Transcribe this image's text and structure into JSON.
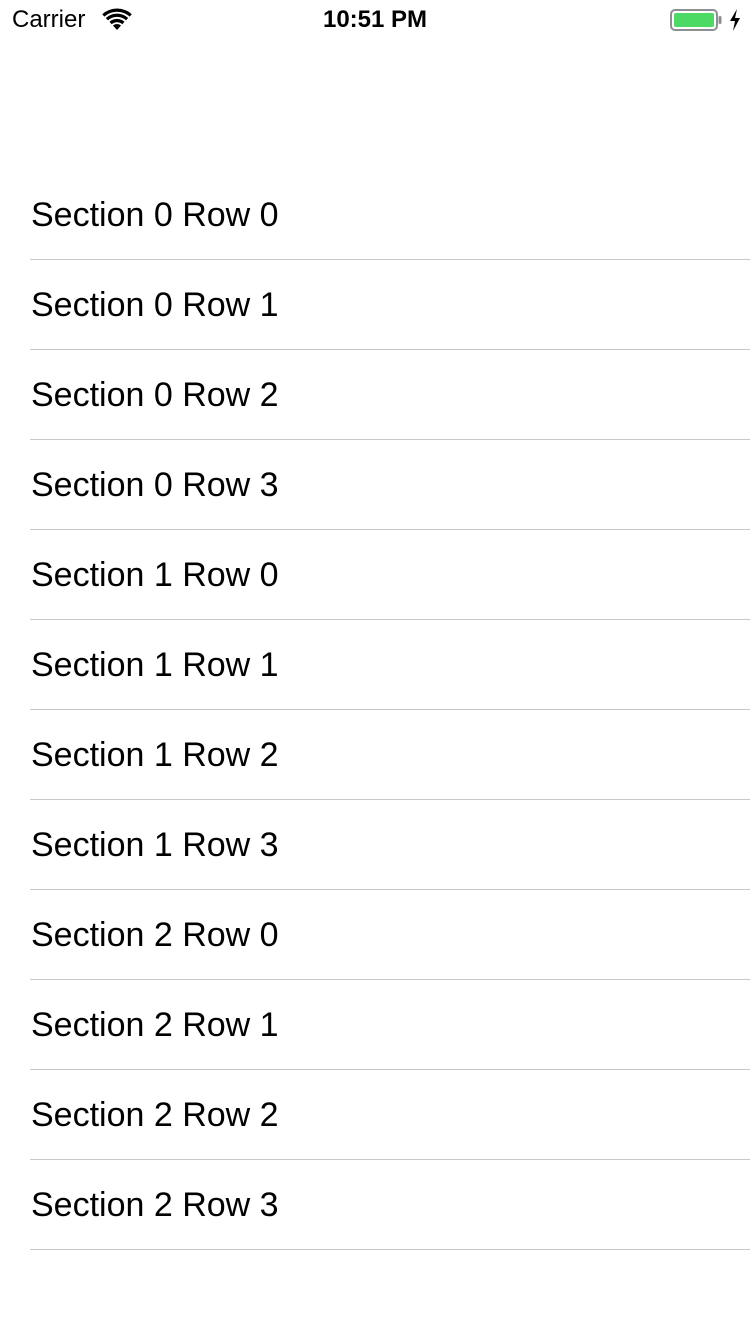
{
  "status_bar": {
    "carrier": "Carrier",
    "time": "10:51 PM",
    "battery_color": "#4cd964",
    "icons": [
      "wifi-icon",
      "battery-icon",
      "charging-bolt-icon"
    ]
  },
  "table": {
    "rows": [
      {
        "label": "Section 0 Row 0"
      },
      {
        "label": "Section 0 Row 1"
      },
      {
        "label": "Section 0 Row 2"
      },
      {
        "label": "Section 0 Row 3"
      },
      {
        "label": "Section 1 Row 0"
      },
      {
        "label": "Section 1 Row 1"
      },
      {
        "label": "Section 1 Row 2"
      },
      {
        "label": "Section 1 Row 3"
      },
      {
        "label": "Section 2 Row 0"
      },
      {
        "label": "Section 2 Row 1"
      },
      {
        "label": "Section 2 Row 2"
      },
      {
        "label": "Section 2 Row 3"
      }
    ]
  }
}
